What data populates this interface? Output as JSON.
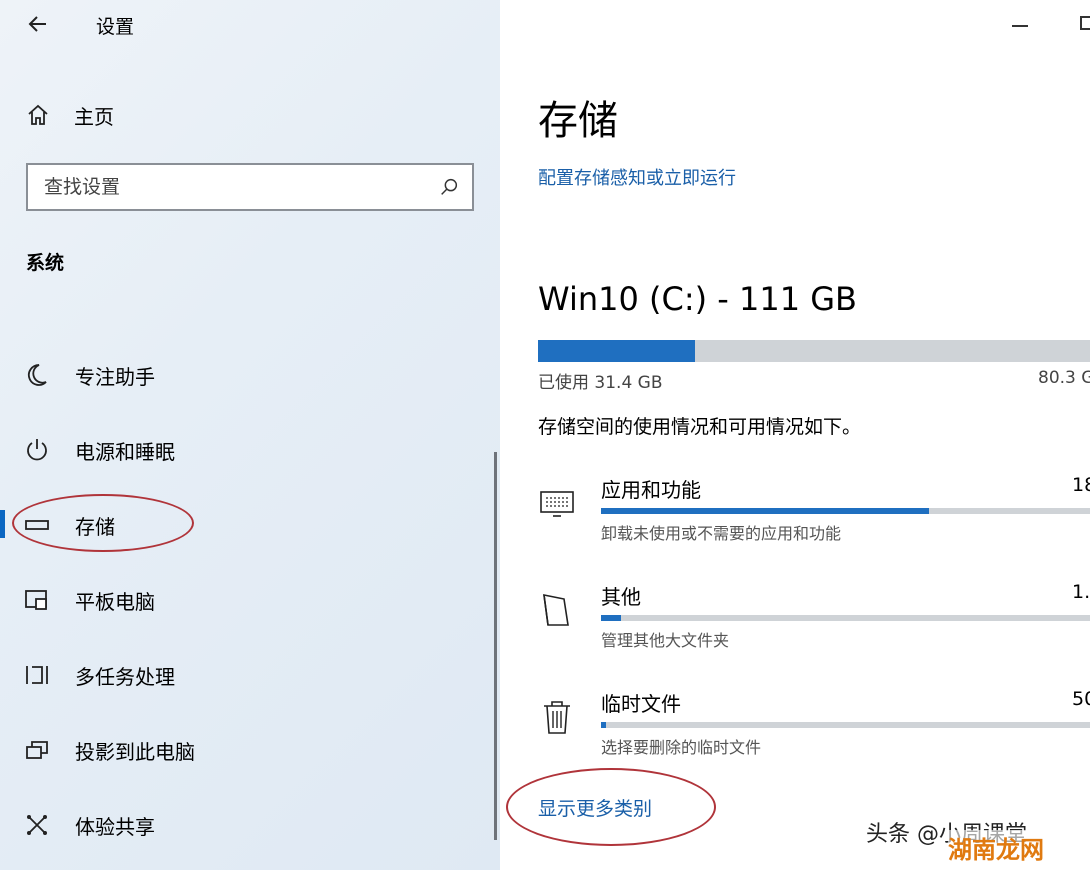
{
  "app_title": "设置",
  "home_label": "主页",
  "search": {
    "placeholder": "查找设置"
  },
  "section_title": "系统",
  "nav": [
    {
      "label": "专注助手",
      "icon": "moon-icon"
    },
    {
      "label": "电源和睡眠",
      "icon": "power-icon"
    },
    {
      "label": "存储",
      "icon": "storage-icon",
      "active": true
    },
    {
      "label": "平板电脑",
      "icon": "tablet-icon"
    },
    {
      "label": "多任务处理",
      "icon": "multitasking-icon"
    },
    {
      "label": "投影到此电脑",
      "icon": "project-icon"
    },
    {
      "label": "体验共享",
      "icon": "share-icon"
    }
  ],
  "main": {
    "title": "存储",
    "config_link": "配置存储感知或立即运行",
    "drive": {
      "title": "Win10 (C:) - 111 GB",
      "used_label": "已使用 31.4 GB",
      "free_label": "80.3 G",
      "used_fraction": 0.28
    },
    "description": "存储空间的使用情况和可用情况如下。",
    "categories": [
      {
        "name": "应用和功能",
        "size": "18",
        "sub": "卸载未使用或不需要的应用和功能",
        "icon": "apps-icon",
        "fraction": 0.67
      },
      {
        "name": "其他",
        "size": "1.",
        "sub": "管理其他大文件夹",
        "icon": "other-files-icon",
        "fraction": 0.04
      },
      {
        "name": "临时文件",
        "size": "50",
        "sub": "选择要删除的临时文件",
        "icon": "trash-icon",
        "fraction": 0.01
      }
    ],
    "more_link": "显示更多类别"
  },
  "watermark": "头条 @小周课堂",
  "watermark2": "湖南龙网",
  "colors": {
    "accent": "#1f6fc0",
    "annotation": "#b0343a"
  }
}
